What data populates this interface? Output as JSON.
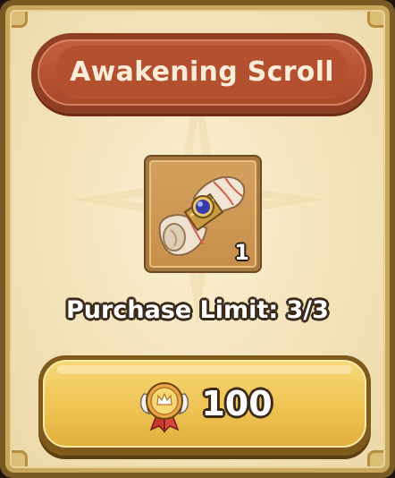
{
  "item": {
    "name": "Awakening Scroll",
    "quantity": "1",
    "icon": "scroll-icon"
  },
  "purchase": {
    "limit_text": "Purchase Limit: 3/3"
  },
  "price": {
    "amount": "100",
    "currency_icon": "medal-currency-icon"
  },
  "colors": {
    "banner": "#a9492b",
    "panel": "#f4e5be",
    "button": "#eec453",
    "frame": "#7a5a24"
  }
}
